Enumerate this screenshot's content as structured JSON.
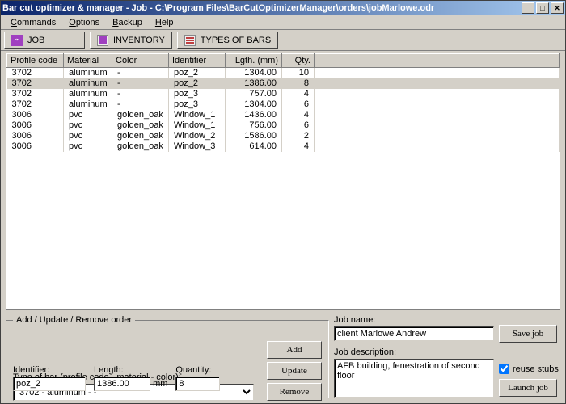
{
  "title": "Bar cut optimizer & manager - Job - C:\\Program Files\\BarCutOptimizerManager\\orders\\jobMarlowe.odr",
  "menu": {
    "commands": "Commands",
    "options": "Options",
    "backup": "Backup",
    "help": "Help"
  },
  "tabs": {
    "job": "JOB",
    "inventory": "INVENTORY",
    "types": "TYPES OF BARS"
  },
  "grid": {
    "headers": {
      "profile": "Profile code",
      "material": "Material",
      "color": "Color",
      "identifier": "Identifier",
      "length": "Lgth. (mm)",
      "qty": "Qty."
    },
    "rows": [
      {
        "profile": "3702",
        "material": "aluminum",
        "color": "-",
        "identifier": "poz_2",
        "length": "1304.00",
        "qty": "10",
        "sel": false
      },
      {
        "profile": "3702",
        "material": "aluminum",
        "color": "-",
        "identifier": "poz_2",
        "length": "1386.00",
        "qty": "8",
        "sel": true
      },
      {
        "profile": "3702",
        "material": "aluminum",
        "color": "-",
        "identifier": "poz_3",
        "length": "757.00",
        "qty": "4",
        "sel": false
      },
      {
        "profile": "3702",
        "material": "aluminum",
        "color": "-",
        "identifier": "poz_3",
        "length": "1304.00",
        "qty": "6",
        "sel": false
      },
      {
        "profile": "3006",
        "material": "pvc",
        "color": "golden_oak",
        "identifier": "Window_1",
        "length": "1436.00",
        "qty": "4",
        "sel": false
      },
      {
        "profile": "3006",
        "material": "pvc",
        "color": "golden_oak",
        "identifier": "Window_1",
        "length": "756.00",
        "qty": "6",
        "sel": false
      },
      {
        "profile": "3006",
        "material": "pvc",
        "color": "golden_oak",
        "identifier": "Window_2",
        "length": "1586.00",
        "qty": "2",
        "sel": false
      },
      {
        "profile": "3006",
        "material": "pvc",
        "color": "golden_oak",
        "identifier": "Window_3",
        "length": "614.00",
        "qty": "4",
        "sel": false
      }
    ]
  },
  "form": {
    "legend": "Add / Update / Remove order",
    "type_label": "Type of bar (profile code - material -  color):",
    "type_value": "3702 - aluminum - -",
    "identifier_label": "Identifier:",
    "identifier_value": "poz_2",
    "length_label": "Length:",
    "length_value": "1386.00",
    "length_unit": "mm",
    "qty_label": "Quantity:",
    "qty_value": "8",
    "add": "Add",
    "update": "Update",
    "remove": "Remove"
  },
  "job": {
    "name_label": "Job name:",
    "name_value": "client Marlowe Andrew",
    "desc_label": "Job description:",
    "desc_value": "AFB building, fenestration of second floor",
    "save": "Save job",
    "reuse": "reuse stubs",
    "launch": "Launch job"
  }
}
